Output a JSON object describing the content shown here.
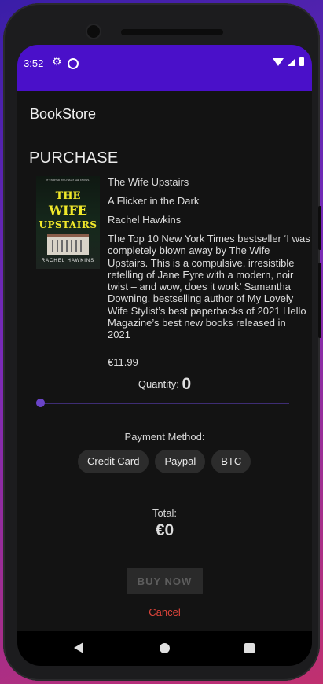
{
  "status_bar": {
    "time": "3:52",
    "gear_icon": "gear-icon",
    "data_saver_icon": "data-saver-icon",
    "wifi_icon": "wifi-icon",
    "signal_icon": "signal-icon",
    "battery_icon": "battery-icon",
    "color": "#4a10c9"
  },
  "app": {
    "title": "BookStore",
    "section_title": "PURCHASE"
  },
  "book": {
    "cover": {
      "tagline": "IT STARTED WITH WHAT SHE KNOWS.",
      "title_line1": "THE",
      "title_line2": "WIFE",
      "title_line3": "UPSTAIRS",
      "author": "RACHEL HAWKINS"
    },
    "title": "The Wife Upstairs",
    "subtitle": "A Flicker in the Dark",
    "author": "Rachel Hawkins",
    "description": "The Top 10 New York Times bestseller ‘I was completely blown away by The Wife Upstairs. This is a compulsive, irresistible retelling of Jane Eyre with a modern, noir twist – and wow, does it work’ Samantha Downing, bestselling author of My Lovely Wife Stylist’s best paperbacks of 2021 Hello Magazine’s best new books released in 2021",
    "price": "€11.99"
  },
  "quantity": {
    "label": "Quantity:",
    "value": "0",
    "slider_level": 0
  },
  "payment": {
    "label": "Payment Method:",
    "options": [
      "Credit Card",
      "Paypal",
      "BTC"
    ]
  },
  "total": {
    "label": "Total:",
    "value": "€0"
  },
  "actions": {
    "buy_label": "BUY NOW",
    "cancel_label": "Cancel",
    "cancel_color": "#e0453b"
  },
  "nav": {
    "back_icon": "back-icon",
    "home_icon": "home-icon",
    "recents_icon": "recents-icon"
  }
}
